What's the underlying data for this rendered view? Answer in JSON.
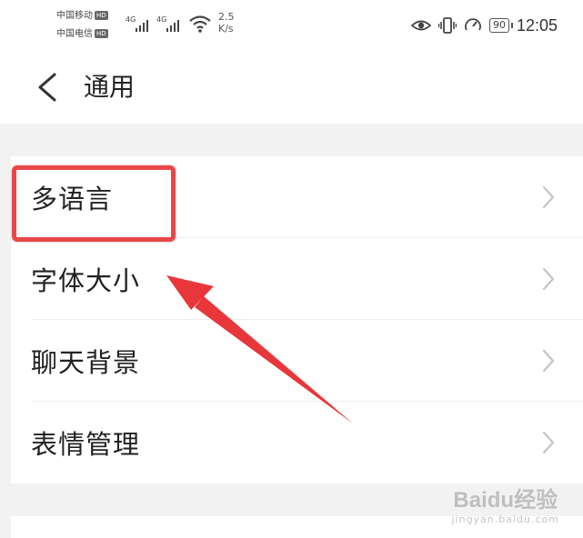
{
  "status_bar": {
    "carrier1": "中国移动",
    "carrier2": "中国电信",
    "hd": "HD",
    "signal1": "4G",
    "signal2": "4G",
    "net_speed_value": "2.5",
    "net_speed_unit": "K/s",
    "battery": "90",
    "time": "12:05"
  },
  "header": {
    "title": "通用"
  },
  "menu": {
    "items": [
      {
        "label": "多语言"
      },
      {
        "label": "字体大小"
      },
      {
        "label": "聊天背景"
      },
      {
        "label": "表情管理"
      }
    ]
  },
  "annotation": {
    "highlight_color": "#e8474a",
    "arrow_color": "#e8363a"
  },
  "watermark": {
    "main": "Baidu经验",
    "sub": "jingyan.baidu.com"
  }
}
